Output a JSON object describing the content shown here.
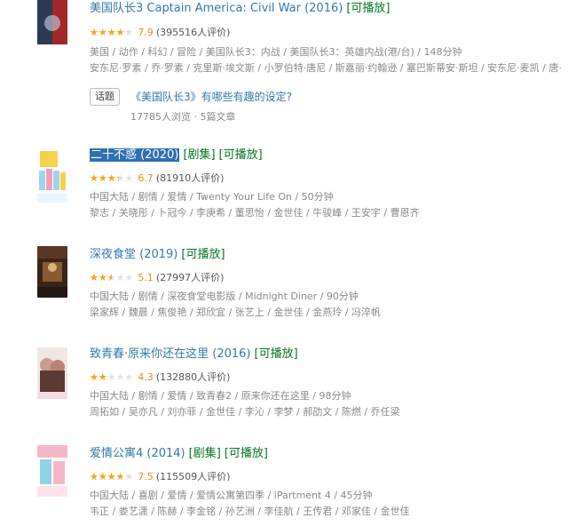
{
  "movies": [
    {
      "title": "美国队长3 Captain America: Civil War (2016)",
      "tags": [
        "[可播放]"
      ],
      "rating": 7.9,
      "rating_text": "7.9",
      "votes": "(395516人评价)",
      "genres": "美国 / 动作 / 科幻 / 冒险 / 美国队长3：内战 / 美国队长3：英雄内战(港/台) / 148分钟",
      "cast": "安东尼·罗素 / 乔·罗素 / 克里斯·埃文斯 / 小罗伯特·唐尼 / 斯嘉丽·约翰逊 / 塞巴斯蒂安·斯坦 / 安东尼·麦凯 / 唐·",
      "colors": [
        "#1b2230",
        "#a02828",
        "#2c3a55"
      ]
    },
    {
      "title": "二十不惑 (2020)",
      "tags": [
        "[剧集]",
        "[可播放]"
      ],
      "rating": 6.7,
      "rating_text": "6.7",
      "votes": "(81910人评价)",
      "genres": "中国大陆 / 剧情 / 爱情 / Twenty Your Life On / 50分钟",
      "cast": "黎志 / 关晓彤 / 卜冠今 / 李庚希 / 董思怡 / 金世佳 / 牛骏峰 / 王安宇 / 曹恩齐",
      "colors": [
        "#f3d24c",
        "#9ed3ec",
        "#ffffff"
      ]
    },
    {
      "title": "深夜食堂 (2019)",
      "tags": [
        "[可播放]"
      ],
      "rating": 5.1,
      "rating_text": "5.1",
      "votes": "(27997人评价)",
      "genres": "中国大陆 / 剧情 / 深夜食堂电影版 / Midnight Diner / 90分钟",
      "cast": "梁家辉 / 魏晨 / 焦俊艳 / 郑欣宜 / 张艺上 / 金世佳 / 金燕玲 / 冯淬帆",
      "colors": [
        "#3a2418",
        "#8a5a34",
        "#d8b27a"
      ]
    },
    {
      "title": "致青春·原来你还在这里 (2016)",
      "tags": [
        "[可播放]"
      ],
      "rating": 4.3,
      "rating_text": "4.3",
      "votes": "(132880人评价)",
      "genres": "中国大陆 / 剧情 / 爱情 / 致青春2 / 原来你还在这里 / 98分钟",
      "cast": "周拓如 / 吴亦凡 / 刘亦菲 / 金世佳 / 李沁 / 李梦 / 郝劭文 / 陈燃 / 乔任梁",
      "colors": [
        "#efe7e3",
        "#c99c8e",
        "#5c3a34"
      ]
    },
    {
      "title": "爱情公寓4 (2014)",
      "tags": [
        "[剧集]",
        "[可播放]"
      ],
      "rating": 7.5,
      "rating_text": "7.5",
      "votes": "(115509人评价)",
      "genres": "中国大陆 / 喜剧 / 爱情 / 爱情公寓第四季 / iPartment 4 / 45分钟",
      "cast": "韦正 / 娄艺潇 / 陈赫 / 李金铭 / 孙艺洲 / 李佳航 / 王传君 / 邓家佳 / 金世佳",
      "colors": [
        "#f4b7c7",
        "#8fd4e4",
        "#ffffff"
      ]
    }
  ],
  "topic": {
    "button_label": "话题",
    "title": "《美国队长3》有哪些有趣的设定?",
    "stats": "17785人浏览 · 5篇文章"
  }
}
